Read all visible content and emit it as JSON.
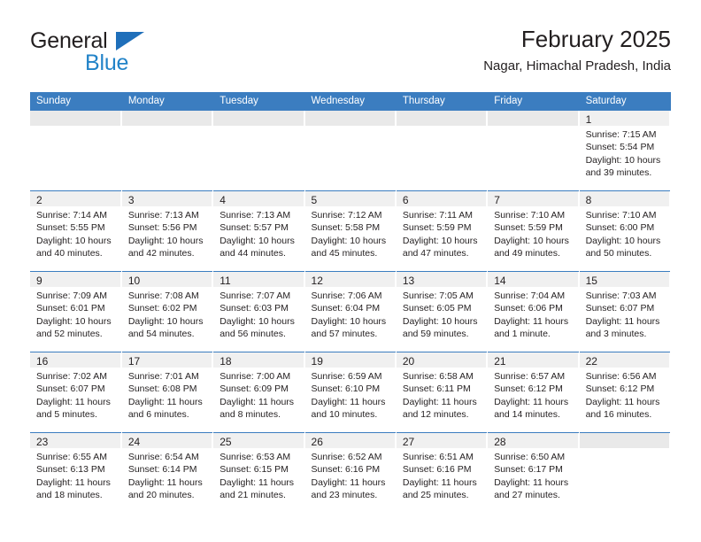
{
  "brand": {
    "name_part1": "General",
    "name_part2": "Blue",
    "triangle_color": "#1f6fba",
    "blue_color": "#2283c8"
  },
  "header": {
    "title": "February 2025",
    "subtitle": "Nagar, Himachal Pradesh, India"
  },
  "theme": {
    "header_bg": "#3b7dc0",
    "header_text": "#ffffff",
    "daynum_band": "#f0f0f0",
    "week_divider": "#3b7dc0",
    "text": "#231f20"
  },
  "calendar": {
    "weekday_headers": [
      "Sunday",
      "Monday",
      "Tuesday",
      "Wednesday",
      "Thursday",
      "Friday",
      "Saturday"
    ],
    "weeks": [
      [
        {
          "day": "",
          "sunrise": "",
          "sunset": "",
          "daylight1": "",
          "daylight2": ""
        },
        {
          "day": "",
          "sunrise": "",
          "sunset": "",
          "daylight1": "",
          "daylight2": ""
        },
        {
          "day": "",
          "sunrise": "",
          "sunset": "",
          "daylight1": "",
          "daylight2": ""
        },
        {
          "day": "",
          "sunrise": "",
          "sunset": "",
          "daylight1": "",
          "daylight2": ""
        },
        {
          "day": "",
          "sunrise": "",
          "sunset": "",
          "daylight1": "",
          "daylight2": ""
        },
        {
          "day": "",
          "sunrise": "",
          "sunset": "",
          "daylight1": "",
          "daylight2": ""
        },
        {
          "day": "1",
          "sunrise": "Sunrise: 7:15 AM",
          "sunset": "Sunset: 5:54 PM",
          "daylight1": "Daylight: 10 hours",
          "daylight2": "and 39 minutes."
        }
      ],
      [
        {
          "day": "2",
          "sunrise": "Sunrise: 7:14 AM",
          "sunset": "Sunset: 5:55 PM",
          "daylight1": "Daylight: 10 hours",
          "daylight2": "and 40 minutes."
        },
        {
          "day": "3",
          "sunrise": "Sunrise: 7:13 AM",
          "sunset": "Sunset: 5:56 PM",
          "daylight1": "Daylight: 10 hours",
          "daylight2": "and 42 minutes."
        },
        {
          "day": "4",
          "sunrise": "Sunrise: 7:13 AM",
          "sunset": "Sunset: 5:57 PM",
          "daylight1": "Daylight: 10 hours",
          "daylight2": "and 44 minutes."
        },
        {
          "day": "5",
          "sunrise": "Sunrise: 7:12 AM",
          "sunset": "Sunset: 5:58 PM",
          "daylight1": "Daylight: 10 hours",
          "daylight2": "and 45 minutes."
        },
        {
          "day": "6",
          "sunrise": "Sunrise: 7:11 AM",
          "sunset": "Sunset: 5:59 PM",
          "daylight1": "Daylight: 10 hours",
          "daylight2": "and 47 minutes."
        },
        {
          "day": "7",
          "sunrise": "Sunrise: 7:10 AM",
          "sunset": "Sunset: 5:59 PM",
          "daylight1": "Daylight: 10 hours",
          "daylight2": "and 49 minutes."
        },
        {
          "day": "8",
          "sunrise": "Sunrise: 7:10 AM",
          "sunset": "Sunset: 6:00 PM",
          "daylight1": "Daylight: 10 hours",
          "daylight2": "and 50 minutes."
        }
      ],
      [
        {
          "day": "9",
          "sunrise": "Sunrise: 7:09 AM",
          "sunset": "Sunset: 6:01 PM",
          "daylight1": "Daylight: 10 hours",
          "daylight2": "and 52 minutes."
        },
        {
          "day": "10",
          "sunrise": "Sunrise: 7:08 AM",
          "sunset": "Sunset: 6:02 PM",
          "daylight1": "Daylight: 10 hours",
          "daylight2": "and 54 minutes."
        },
        {
          "day": "11",
          "sunrise": "Sunrise: 7:07 AM",
          "sunset": "Sunset: 6:03 PM",
          "daylight1": "Daylight: 10 hours",
          "daylight2": "and 56 minutes."
        },
        {
          "day": "12",
          "sunrise": "Sunrise: 7:06 AM",
          "sunset": "Sunset: 6:04 PM",
          "daylight1": "Daylight: 10 hours",
          "daylight2": "and 57 minutes."
        },
        {
          "day": "13",
          "sunrise": "Sunrise: 7:05 AM",
          "sunset": "Sunset: 6:05 PM",
          "daylight1": "Daylight: 10 hours",
          "daylight2": "and 59 minutes."
        },
        {
          "day": "14",
          "sunrise": "Sunrise: 7:04 AM",
          "sunset": "Sunset: 6:06 PM",
          "daylight1": "Daylight: 11 hours",
          "daylight2": "and 1 minute."
        },
        {
          "day": "15",
          "sunrise": "Sunrise: 7:03 AM",
          "sunset": "Sunset: 6:07 PM",
          "daylight1": "Daylight: 11 hours",
          "daylight2": "and 3 minutes."
        }
      ],
      [
        {
          "day": "16",
          "sunrise": "Sunrise: 7:02 AM",
          "sunset": "Sunset: 6:07 PM",
          "daylight1": "Daylight: 11 hours",
          "daylight2": "and 5 minutes."
        },
        {
          "day": "17",
          "sunrise": "Sunrise: 7:01 AM",
          "sunset": "Sunset: 6:08 PM",
          "daylight1": "Daylight: 11 hours",
          "daylight2": "and 6 minutes."
        },
        {
          "day": "18",
          "sunrise": "Sunrise: 7:00 AM",
          "sunset": "Sunset: 6:09 PM",
          "daylight1": "Daylight: 11 hours",
          "daylight2": "and 8 minutes."
        },
        {
          "day": "19",
          "sunrise": "Sunrise: 6:59 AM",
          "sunset": "Sunset: 6:10 PM",
          "daylight1": "Daylight: 11 hours",
          "daylight2": "and 10 minutes."
        },
        {
          "day": "20",
          "sunrise": "Sunrise: 6:58 AM",
          "sunset": "Sunset: 6:11 PM",
          "daylight1": "Daylight: 11 hours",
          "daylight2": "and 12 minutes."
        },
        {
          "day": "21",
          "sunrise": "Sunrise: 6:57 AM",
          "sunset": "Sunset: 6:12 PM",
          "daylight1": "Daylight: 11 hours",
          "daylight2": "and 14 minutes."
        },
        {
          "day": "22",
          "sunrise": "Sunrise: 6:56 AM",
          "sunset": "Sunset: 6:12 PM",
          "daylight1": "Daylight: 11 hours",
          "daylight2": "and 16 minutes."
        }
      ],
      [
        {
          "day": "23",
          "sunrise": "Sunrise: 6:55 AM",
          "sunset": "Sunset: 6:13 PM",
          "daylight1": "Daylight: 11 hours",
          "daylight2": "and 18 minutes."
        },
        {
          "day": "24",
          "sunrise": "Sunrise: 6:54 AM",
          "sunset": "Sunset: 6:14 PM",
          "daylight1": "Daylight: 11 hours",
          "daylight2": "and 20 minutes."
        },
        {
          "day": "25",
          "sunrise": "Sunrise: 6:53 AM",
          "sunset": "Sunset: 6:15 PM",
          "daylight1": "Daylight: 11 hours",
          "daylight2": "and 21 minutes."
        },
        {
          "day": "26",
          "sunrise": "Sunrise: 6:52 AM",
          "sunset": "Sunset: 6:16 PM",
          "daylight1": "Daylight: 11 hours",
          "daylight2": "and 23 minutes."
        },
        {
          "day": "27",
          "sunrise": "Sunrise: 6:51 AM",
          "sunset": "Sunset: 6:16 PM",
          "daylight1": "Daylight: 11 hours",
          "daylight2": "and 25 minutes."
        },
        {
          "day": "28",
          "sunrise": "Sunrise: 6:50 AM",
          "sunset": "Sunset: 6:17 PM",
          "daylight1": "Daylight: 11 hours",
          "daylight2": "and 27 minutes."
        },
        {
          "day": "",
          "sunrise": "",
          "sunset": "",
          "daylight1": "",
          "daylight2": ""
        }
      ]
    ]
  }
}
